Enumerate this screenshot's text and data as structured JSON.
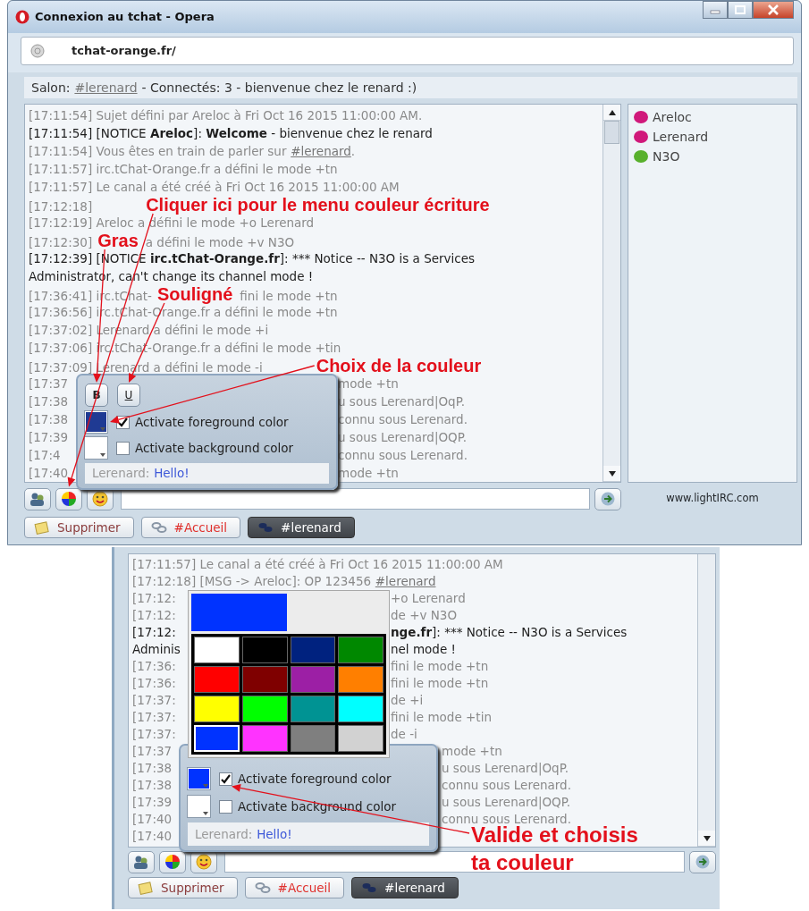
{
  "window": {
    "title": "Connexion au tchat - Opera",
    "address": "tchat-orange.fr/"
  },
  "topic": {
    "label": "Salon:",
    "channel": "#lerenard",
    "text": "- Connectés: 3 - bienvenue chez le renard :)"
  },
  "chat": [
    {
      "kind": "full",
      "dark": false,
      "text": "[17:11:54] Sujet défini par Areloc à Fri Oct 16 2015 11:00:00 AM."
    },
    {
      "kind": "full",
      "dark": true,
      "text": "[17:11:54] [NOTICE **Areloc**]: **Welcome** - bienvenue chez le renard"
    },
    {
      "kind": "full",
      "dark": false,
      "text": "[17:11:54] Vous êtes en train de parler sur",
      "link": "#lerenard",
      "after": "."
    },
    {
      "kind": "full",
      "dark": false,
      "text": "[17:11:57] irc.tChat-Orange.fr a défini le mode +tn"
    },
    {
      "kind": "full",
      "dark": false,
      "text": "[17:11:57] Le canal a été créé à Fri Oct 16 2015 11:00:00 AM"
    },
    {
      "kind": "full",
      "dark": false,
      "text": "[17:12:18]",
      "note": "Cliquer ici pour le menu couleur écriture"
    },
    {
      "kind": "full",
      "dark": false,
      "text": "[17:12:19] Areloc a défini le mode +o Lerenard"
    },
    {
      "kind": "full",
      "dark": false,
      "text": "[17:12:30]",
      "note": "Gras",
      "right": "a défini le mode +v N3O"
    },
    {
      "kind": "full",
      "dark": true,
      "text": "[17:12:39] [NOTICE **irc.tChat-Orange.fr**]: *** Notice -- N3O is a Services"
    },
    {
      "kind": "full",
      "dark": true,
      "text": "Administrator, can't change its channel mode !"
    },
    {
      "kind": "full",
      "dark": false,
      "text": "[17:36:41] irc.tChat-",
      "note": "Souligné",
      "right": "fini le mode +tn"
    },
    {
      "kind": "full",
      "dark": false,
      "text": "[17:36:56] irc.tChat-Orange.fr a défini le mode +tn"
    },
    {
      "kind": "full",
      "dark": false,
      "text": "[17:37:02] Lerenard a défini le mode +i"
    },
    {
      "kind": "full",
      "dark": false,
      "text": "[17:37:06] irc.tChat-Orange.fr a défini le mode +tin"
    },
    {
      "kind": "full",
      "dark": false,
      "text": "[17:37:09] Lerenard a défini le mode -i",
      "note": "Choix de la couleur"
    },
    {
      "kind": "popup",
      "dark": false,
      "text": "[17:37",
      "right": "mode +tn"
    },
    {
      "kind": "popup",
      "dark": false,
      "text": "[17:38",
      "right": "u sous Lerenard|OqP."
    },
    {
      "kind": "popup",
      "dark": false,
      "text": "[17:38",
      "right": "connu sous Lerenard."
    },
    {
      "kind": "popup",
      "dark": false,
      "text": "[17:39",
      "right": "u sous Lerenard|OQP."
    },
    {
      "kind": "popup",
      "dark": false,
      "text": "[17:4",
      "right": "connu sous Lerenard."
    },
    {
      "kind": "popup",
      "dark": false,
      "text": "[17:40",
      "right": "mode +tn"
    }
  ],
  "users": [
    {
      "name": "Areloc",
      "color": "#d0187a"
    },
    {
      "name": "Lerenard",
      "color": "#d0187a"
    },
    {
      "name": "N3O",
      "color": "#58b02c"
    }
  ],
  "credit_link": "www.lightIRC.com",
  "format_popup": {
    "bold": "B",
    "underline": "U",
    "foreground": {
      "color": "#1f3a93",
      "label": "Activate foreground color",
      "checked": true
    },
    "background": {
      "color": "#ffffff",
      "label": "Activate background color",
      "checked": false
    },
    "preview": {
      "nick": "Lerenard:",
      "message": "Hello!"
    }
  },
  "tabs": [
    {
      "kind": "action",
      "label": "Supprimer",
      "selected": false,
      "unread": false
    },
    {
      "kind": "channel",
      "label": "#Accueil",
      "selected": false,
      "unread": true
    },
    {
      "kind": "channel",
      "label": "#lerenard",
      "selected": true,
      "unread": false
    }
  ],
  "detail_view": {
    "chat": [
      {
        "kind": "full",
        "dark": false,
        "text": "[17:11:57] Le canal a été créé à Fri Oct 16 2015 11:00:00 AM"
      },
      {
        "kind": "full",
        "dark": false,
        "text": "[17:12:18] [MSG -> Areloc]: OP 123456",
        "link": "#lerenard"
      },
      {
        "kind": "picker",
        "dark": false,
        "text": "[17:12:",
        "right": "+o Lerenard"
      },
      {
        "kind": "picker",
        "dark": false,
        "text": "[17:12:",
        "right": "de +v N3O"
      },
      {
        "kind": "picker",
        "dark": true,
        "text": "[17:12:",
        "right": "**nge.fr**]: *** Notice -- N3O is a Services"
      },
      {
        "kind": "picker",
        "dark": true,
        "text": "Adminis",
        "right": "nel mode !"
      },
      {
        "kind": "picker",
        "dark": false,
        "text": "[17:36:",
        "right": "fini le mode +tn"
      },
      {
        "kind": "picker",
        "dark": false,
        "text": "[17:36:",
        "right": "fini le mode +tn"
      },
      {
        "kind": "picker",
        "dark": false,
        "text": "[17:37:",
        "right": "de +i"
      },
      {
        "kind": "picker",
        "dark": false,
        "text": "[17:37:",
        "right": "fini le mode +tin"
      },
      {
        "kind": "picker",
        "dark": false,
        "text": "[17:37:",
        "right": "de -i"
      },
      {
        "kind": "popup",
        "dark": false,
        "text": "[17:37",
        "right": "mode +tn"
      },
      {
        "kind": "popup",
        "dark": false,
        "text": "[17:38",
        "right": "u sous Lerenard|OqP."
      },
      {
        "kind": "popup",
        "dark": false,
        "text": "[17:38",
        "right": "connu sous Lerenard."
      },
      {
        "kind": "popup",
        "dark": false,
        "text": "[17:39",
        "right": "u sous Lerenard|OQP."
      },
      {
        "kind": "popup",
        "dark": false,
        "text": "[17:40",
        "right": "connu sous Lerenard."
      },
      {
        "kind": "popup",
        "dark": false,
        "text": "[17:40"
      }
    ],
    "picker": {
      "swatches": [
        {
          "color": "#ffffff",
          "selected": false
        },
        {
          "color": "#000000",
          "selected": false
        },
        {
          "color": "#00227f",
          "selected": false
        },
        {
          "color": "#008800",
          "selected": false
        },
        {
          "color": "#ff0000",
          "selected": false
        },
        {
          "color": "#7f0000",
          "selected": false
        },
        {
          "color": "#9c1fa5",
          "selected": false
        },
        {
          "color": "#ff7f00",
          "selected": false
        },
        {
          "color": "#ffff00",
          "selected": false
        },
        {
          "color": "#00ff00",
          "selected": false
        },
        {
          "color": "#009393",
          "selected": false
        },
        {
          "color": "#00ffff",
          "selected": false
        },
        {
          "color": "#0033ff",
          "selected": true
        },
        {
          "color": "#ff33ff",
          "selected": false
        },
        {
          "color": "#7f7f7f",
          "selected": false
        },
        {
          "color": "#d2d2d2",
          "selected": false
        }
      ]
    },
    "format_popup": {
      "foreground": {
        "color": "#0033ff",
        "label": "Activate foreground color",
        "checked": true
      },
      "background": {
        "color": "#ffffff",
        "label": "Activate background color",
        "checked": false
      },
      "preview": {
        "nick": "Lerenard:",
        "message": "Hello!"
      }
    },
    "annotation": "Valide et choisis ta couleur",
    "tabs": [
      {
        "kind": "action",
        "label": "Supprimer",
        "selected": false,
        "unread": false
      },
      {
        "kind": "channel",
        "label": "#Accueil",
        "selected": false,
        "unread": true
      },
      {
        "kind": "channel",
        "label": "#lerenard",
        "selected": true,
        "unread": false
      }
    ]
  }
}
